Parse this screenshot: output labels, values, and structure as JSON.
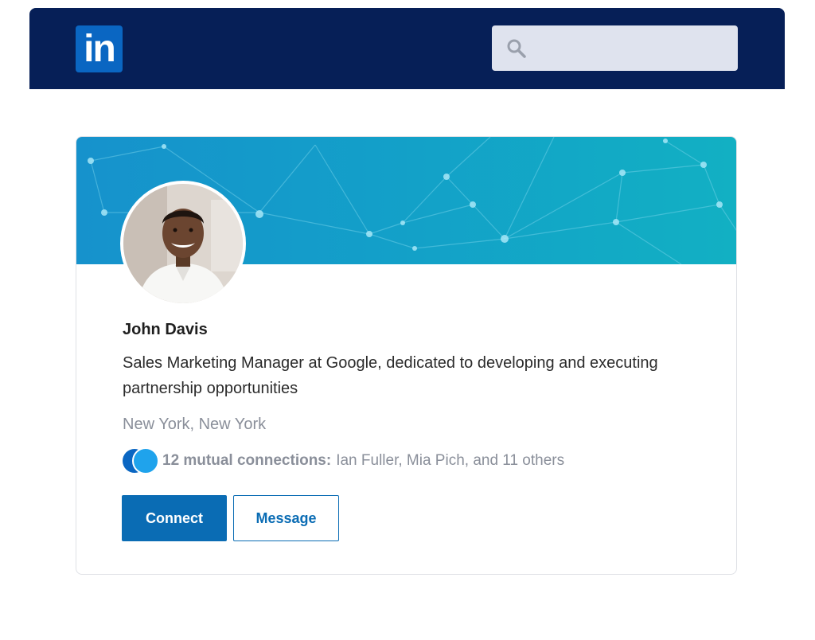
{
  "header": {
    "logo_text": "in",
    "search": {
      "placeholder": "",
      "value": ""
    }
  },
  "profile": {
    "name": "John Davis",
    "headline": "Sales Marketing Manager at Google, dedicated to developing and executing partnership opportunities",
    "location": "New York, New York",
    "mutual": {
      "count_label": "12 mutual connections:",
      "names": "Ian Fuller, Mia Pich, and 11 others"
    }
  },
  "actions": {
    "connect_label": "Connect",
    "message_label": "Message"
  },
  "colors": {
    "header_bg": "#061f57",
    "brand_blue": "#0a66c2",
    "banner_start": "#1692cc",
    "banner_end": "#12b0c3",
    "muted_text": "#8a8f9a"
  },
  "icons": {
    "search": "search-icon",
    "avatar": "avatar"
  }
}
